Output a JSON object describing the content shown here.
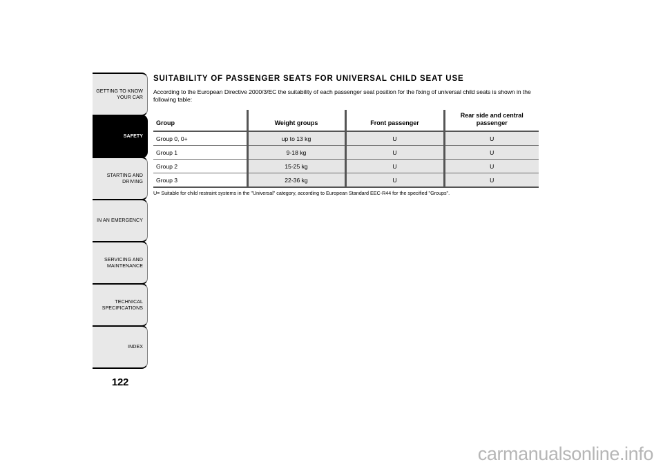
{
  "sidebar": {
    "tabs": [
      {
        "label": "GETTING TO KNOW\nYOUR CAR",
        "active": false
      },
      {
        "label": "SAFETY",
        "active": true
      },
      {
        "label": "STARTING AND\nDRIVING",
        "active": false
      },
      {
        "label": "IN AN EMERGENCY",
        "active": false
      },
      {
        "label": "SERVICING AND\nMAINTENANCE",
        "active": false
      },
      {
        "label": "TECHNICAL\nSPECIFICATIONS",
        "active": false
      },
      {
        "label": "INDEX",
        "active": false
      }
    ],
    "page_number": "122"
  },
  "content": {
    "title": "SUITABILITY OF PASSENGER SEATS FOR UNIVERSAL CHILD SEAT USE",
    "intro": "According to the European Directive 2000/3/EC the suitability of each passenger seat position for the fixing of universal child seats is shown in the following table:",
    "footnote": "U= Suitable for child restraint systems in the \"Universal\" category, according to European Standard EEC-R44 for the specified \"Groups\"."
  },
  "table": {
    "headers": {
      "group": "Group",
      "weight": "Weight groups",
      "front": "Front passenger",
      "rear": "Rear side and central passenger"
    },
    "rows": [
      {
        "group": "Group 0, 0+",
        "weight": "up to 13 kg",
        "front": "U",
        "rear": "U"
      },
      {
        "group": "Group 1",
        "weight": "9-18 kg",
        "front": "U",
        "rear": "U"
      },
      {
        "group": "Group 2",
        "weight": "15-25 kg",
        "front": "U",
        "rear": "U"
      },
      {
        "group": "Group 3",
        "weight": "22-36 kg",
        "front": "U",
        "rear": "U"
      }
    ]
  },
  "watermark": {
    "text": "carmanualsonline.info"
  },
  "colors": {
    "active_tab_bg": "#000000",
    "tab_bg": "#e8e8e8",
    "cell_shaded": "#e6e6e6",
    "rule": "#555555",
    "watermark": "#b6b6b6"
  }
}
